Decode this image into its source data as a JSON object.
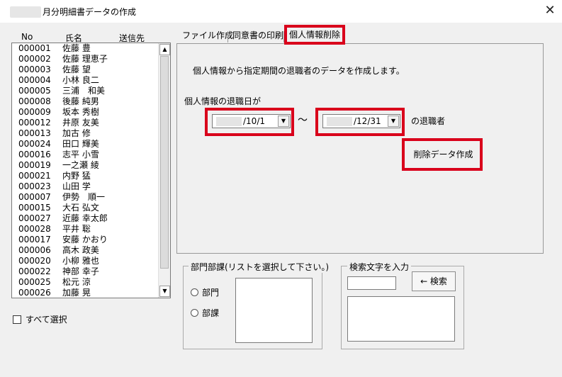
{
  "window": {
    "title": "月分明細書データの作成",
    "close_glyph": "✕"
  },
  "list": {
    "headers": {
      "no": "No",
      "name": "氏名",
      "dest": "送信先"
    },
    "rows": [
      {
        "no": "000001",
        "name": "佐藤 豊"
      },
      {
        "no": "000002",
        "name": "佐藤 理恵子"
      },
      {
        "no": "000003",
        "name": "佐藤 望"
      },
      {
        "no": "000004",
        "name": "小林 良二"
      },
      {
        "no": "000005",
        "name": "三浦　和美"
      },
      {
        "no": "000008",
        "name": "後藤 純男"
      },
      {
        "no": "000009",
        "name": "坂本 秀樹"
      },
      {
        "no": "000012",
        "name": "井原 友美"
      },
      {
        "no": "000013",
        "name": "加古 修"
      },
      {
        "no": "000024",
        "name": "田口 輝美"
      },
      {
        "no": "000016",
        "name": "志平 小雪"
      },
      {
        "no": "000019",
        "name": "一之瀬 綾"
      },
      {
        "no": "000021",
        "name": "内野 猛"
      },
      {
        "no": "000023",
        "name": "山田 学"
      },
      {
        "no": "000007",
        "name": "伊勢　順一"
      },
      {
        "no": "000015",
        "name": "大石 弘文"
      },
      {
        "no": "000027",
        "name": "近藤 幸太郎"
      },
      {
        "no": "000028",
        "name": "平井 聡"
      },
      {
        "no": "000017",
        "name": "安藤 かおり"
      },
      {
        "no": "000006",
        "name": "高木 政美"
      },
      {
        "no": "000020",
        "name": "小柳 雅也"
      },
      {
        "no": "000022",
        "name": "神部 幸子"
      },
      {
        "no": "000025",
        "name": "松元 涼"
      },
      {
        "no": "000026",
        "name": "加藤 晃"
      }
    ],
    "scroll_up": "▲",
    "scroll_down": "▼"
  },
  "select_all": {
    "label": "すべて選択",
    "checked": false
  },
  "tabs": [
    {
      "label": "ファイル作成",
      "active": false
    },
    {
      "label": "同意書の印刷",
      "active": false
    },
    {
      "label": "個人情報削除",
      "active": true
    }
  ],
  "panel": {
    "description": "個人情報から指定期間の退職者のデータを作成します。",
    "date_label": "個人情報の退職日が",
    "from_date": "/10/1",
    "to_date": "/12/31",
    "tilde": "〜",
    "retiree_label": "の退職者",
    "delete_button": "削除データ作成",
    "dropdown_glyph": "▼"
  },
  "dept_group": {
    "label": "部門部課(リストを選択して下さい。)",
    "radio_dept": "部門",
    "radio_section": "部課"
  },
  "search_group": {
    "label": "検索文字を入力",
    "input_value": "",
    "button": "← 検索"
  },
  "colors": {
    "highlight": "#d9001b"
  }
}
